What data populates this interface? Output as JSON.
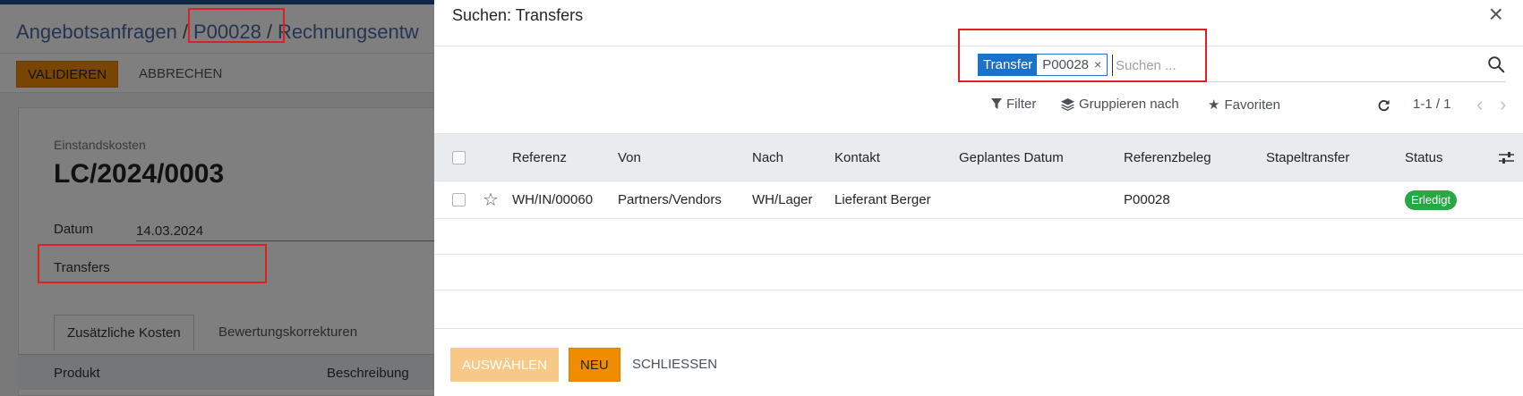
{
  "background": {
    "breadcrumb": [
      "Angebotsanfragen",
      "P00028",
      "Rechnungsentw"
    ],
    "breadcrumb_sep": "/",
    "toolbar": {
      "validate_label": "VALIDIEREN",
      "cancel_label": "ABBRECHEN"
    },
    "form": {
      "record_type": "Einstandskosten",
      "record_name": "LC/2024/0003",
      "date_label": "Datum",
      "date_value": "14.03.2024",
      "transfers_label": "Transfers"
    },
    "tabs": [
      "Zusätzliche Kosten",
      "Bewertungskorrekturen"
    ],
    "table_headers": [
      "Produkt",
      "Beschreibung"
    ]
  },
  "modal": {
    "title": "Suchen: Transfers",
    "close_icon": "×",
    "search": {
      "facet_label": "Transfer",
      "facet_value": "P00028",
      "facet_remove": "×",
      "placeholder": "Suchen ..."
    },
    "filterbar": {
      "filter_label": "Filter",
      "group_label": "Gruppieren nach",
      "favorites_label": "Favoriten"
    },
    "pager": {
      "value": "1-1 / 1",
      "prev": "‹",
      "next": "›"
    },
    "columns": [
      "Referenz",
      "Von",
      "Nach",
      "Kontakt",
      "Geplantes Datum",
      "Referenzbeleg",
      "Stapeltransfer",
      "Status"
    ],
    "rows": [
      {
        "referenz": "WH/IN/00060",
        "von": "Partners/Vendors",
        "nach": "WH/Lager",
        "kontakt": "Lieferant Berger",
        "geplantes_datum": "",
        "referenzbeleg": "P00028",
        "stapeltransfer": "",
        "status": "Erledigt"
      }
    ],
    "footer": {
      "select_label": "AUSWÄHLEN",
      "new_label": "NEU",
      "close_label": "SCHLIESSEN"
    }
  },
  "colors": {
    "accent_orange": "#f08c00",
    "facet_blue": "#1a73c8",
    "status_green": "#28a745",
    "annotation_red": "#e02020"
  }
}
